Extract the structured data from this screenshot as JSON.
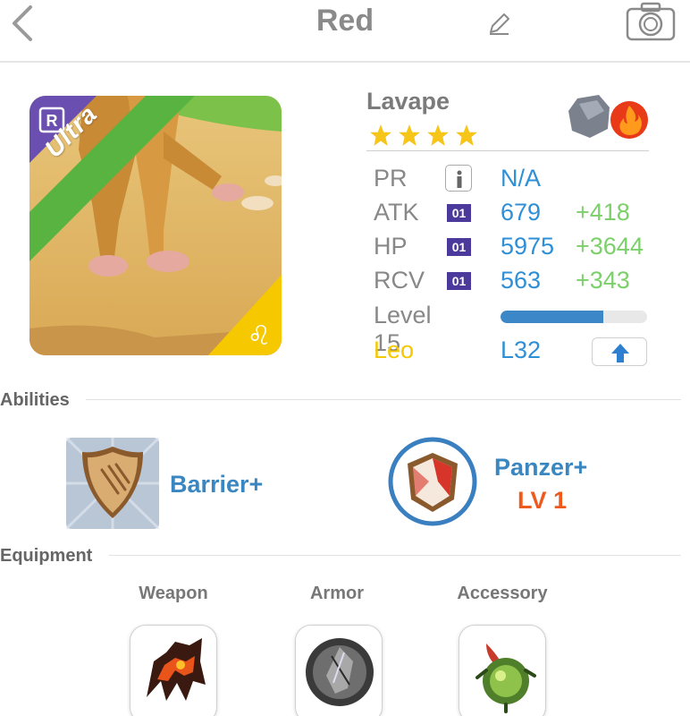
{
  "header": {
    "title": "Red",
    "icons": {
      "back": "back-chevron-icon",
      "edit": "pencil-icon",
      "camera": "camera-icon"
    }
  },
  "monster": {
    "rarity": "Ultra",
    "rarity_badge": "R",
    "name": "Lavape",
    "stars": 4,
    "elements": [
      "rock-element-icon",
      "fire-element-icon"
    ],
    "zodiac_icon": "leo-zodiac-icon"
  },
  "stats": {
    "pr": {
      "label": "PR",
      "value": "N/A"
    },
    "atk": {
      "label": "ATK",
      "badge": "01",
      "value": "679",
      "bonus": "+418"
    },
    "hp": {
      "label": "HP",
      "badge": "01",
      "value": "5975",
      "bonus": "+3644"
    },
    "rcv": {
      "label": "RCV",
      "badge": "01",
      "value": "563",
      "bonus": "+343"
    },
    "level": {
      "label": "Level 15",
      "progress": 0.7
    },
    "sign": {
      "label": "Leo",
      "value": "L32"
    }
  },
  "abilities": {
    "heading": "Abilities",
    "items": [
      {
        "name": "Barrier+",
        "icon": "shield-ability-icon"
      },
      {
        "name": "Panzer+",
        "level": "LV 1",
        "icon": "panzer-ability-icon"
      }
    ]
  },
  "equipment": {
    "heading": "Equipment",
    "slots": [
      {
        "label": "Weapon",
        "icon": "lava-claw-weapon-icon"
      },
      {
        "label": "Armor",
        "icon": "stone-shield-armor-icon"
      },
      {
        "label": "Accessory",
        "icon": "green-orb-accessory-icon"
      }
    ]
  },
  "colors": {
    "value_blue": "#2f8fd6",
    "bonus_green": "#7bd06a",
    "leo_yellow": "#f5c800",
    "ultra_green": "#59b341",
    "level_orange": "#ef5a1c"
  }
}
